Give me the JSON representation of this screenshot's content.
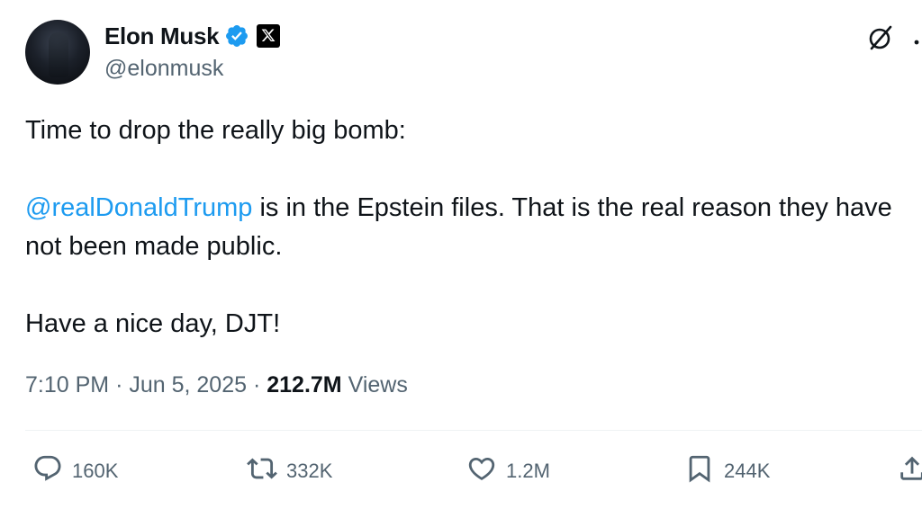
{
  "author": {
    "display_name": "Elon Musk",
    "handle": "@elonmusk",
    "verified_icon": "verified-badge-icon",
    "affiliate_icon": "x-logo-icon",
    "verified_color": "#1d9bf0"
  },
  "header_icons": {
    "grok": "grok-icon",
    "more": "more-icon"
  },
  "tweet": {
    "line1": "Time to drop the really big bomb:",
    "mention": "@realDonaldTrump",
    "line2_rest": " is in the Epstein files. That is the real reason they have not been made public.",
    "line3": "Have a nice day, DJT!",
    "mention_color": "#1d9bf0"
  },
  "meta": {
    "time": "7:10 PM",
    "separator": "·",
    "date": "Jun 5, 2025",
    "views_count": "212.7M",
    "views_label": "Views"
  },
  "actions": {
    "reply_count": "160K",
    "repost_count": "332K",
    "like_count": "1.2M",
    "bookmark_count": "244K"
  },
  "colors": {
    "text_primary": "#0f1419",
    "text_secondary": "#536471",
    "divider": "#eff3f4"
  }
}
